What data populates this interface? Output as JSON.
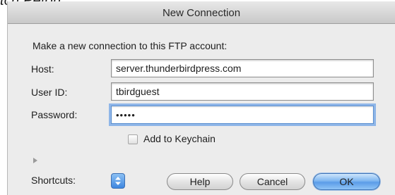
{
  "caption_fragment": "tch Peton.",
  "dialog": {
    "title": "New Connection",
    "instructions": "Make a new connection to this FTP account:",
    "host": {
      "label": "Host:",
      "value": "server.thunderbirdpress.com"
    },
    "user_id": {
      "label": "User ID:",
      "value": "tbirdguest"
    },
    "password": {
      "label": "Password:",
      "masked_value": "•••••"
    },
    "keychain": {
      "label": "Add to Keychain",
      "checked": false
    },
    "shortcuts": {
      "label": "Shortcuts:"
    },
    "buttons": {
      "help": "Help",
      "cancel": "Cancel",
      "ok": "OK"
    }
  },
  "colors": {
    "dialog_background": "#ececec",
    "focus_ring": "#8fb6e8",
    "default_button": "#5b9de8"
  },
  "icons": {
    "disclosure": "disclosure-triangle-icon",
    "shortcuts": "up-down-stepper-icon"
  }
}
